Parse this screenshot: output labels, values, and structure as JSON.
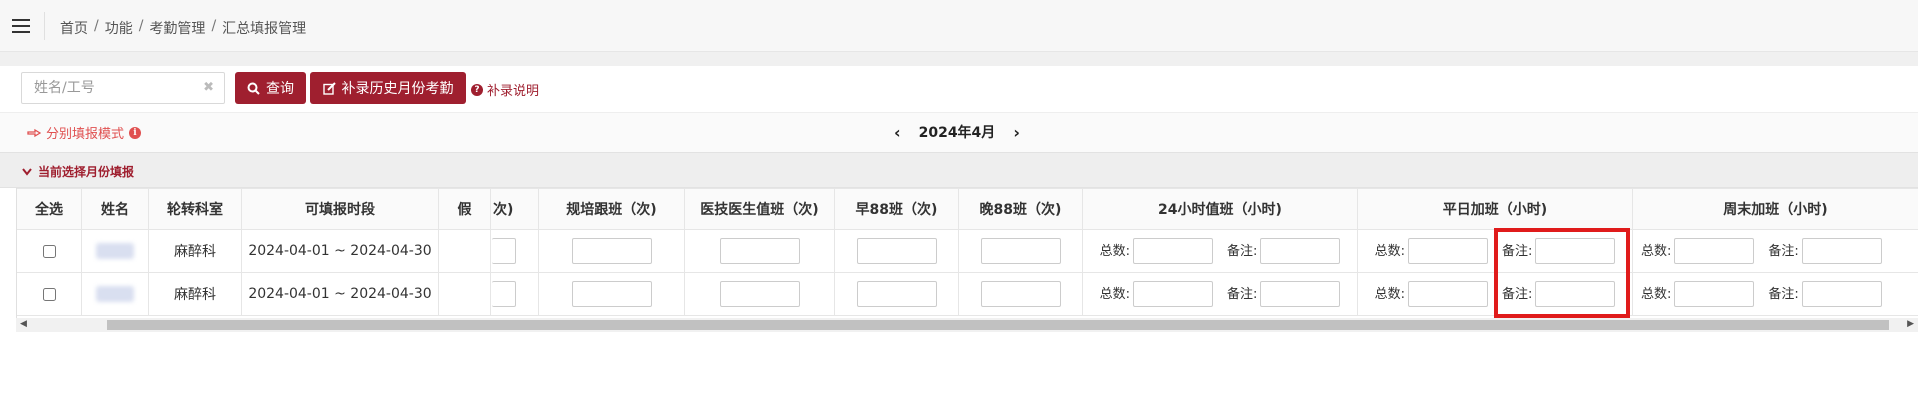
{
  "breadcrumb": [
    "首页",
    "功能",
    "考勤管理",
    "汇总填报管理"
  ],
  "breadcrumb_sep": "/",
  "search": {
    "placeholder": "姓名/工号"
  },
  "buttons": {
    "query": "查询",
    "supplement": "补录历史月份考勤",
    "help": "补录说明"
  },
  "mode": {
    "label": "分别填报模式"
  },
  "month": {
    "current": "2024年4月"
  },
  "section": {
    "label": "当前选择月份填报"
  },
  "table": {
    "headers": [
      "全选",
      "姓名",
      "轮转科室",
      "可填报时段",
      "假",
      "次)",
      "规培跟班（次)",
      "医技医生值班（次)",
      "早88班（次)",
      "晚88班（次)",
      "24小时值班（小时)",
      "平日加班（小时)",
      "周末加班（小时)"
    ],
    "sub_labels": {
      "total": "总数:",
      "remark": "备注:"
    },
    "rows": [
      {
        "dept": "麻醉科",
        "period": "2024-04-01 ~ 2024-04-30"
      },
      {
        "dept": "麻醉科",
        "period": "2024-04-01 ~ 2024-04-30"
      }
    ]
  },
  "colors": {
    "primary": "#9f1f2f",
    "accent_link": "#e05050",
    "highlight": "#e01b1b"
  },
  "icons": [
    "menu-icon",
    "clear-icon",
    "search-icon",
    "edit-icon",
    "question-circle-icon",
    "hand-point-icon",
    "info-circle-icon",
    "chevron-left-icon",
    "chevron-right-icon",
    "chevron-down-icon"
  ]
}
